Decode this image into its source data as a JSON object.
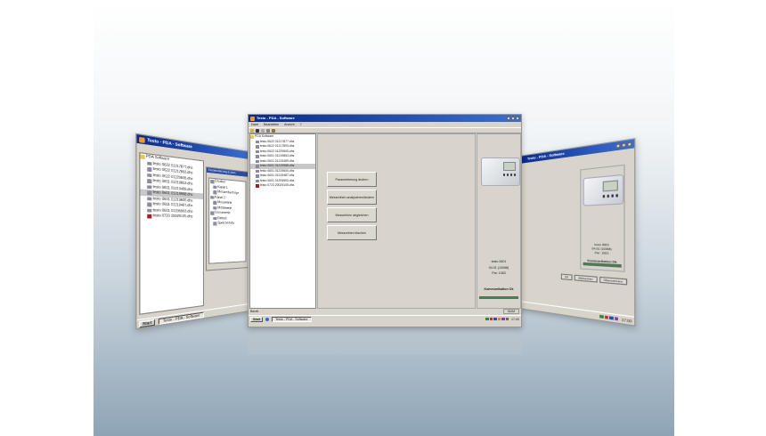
{
  "app": {
    "title": "Testo - PDA - Software",
    "menu": [
      "Datei",
      "Bearbeiten",
      "Ansicht",
      "?"
    ]
  },
  "tree": {
    "root": "PDA Software",
    "items": [
      "testo 0622 01217877.dhs",
      "testo 0622 01217893.dhs",
      "testo 0622 01229505.dhs",
      "testo 0601 01219853.dhs",
      "testo 0601 01219489.dhs",
      "testo 0601 01219988.dhs",
      "testo 0601 01219600.dhs",
      "testo 0601 01219487.dhs",
      "testo 0601 01205993.dhs",
      "testo 0723 20029105.dhs"
    ],
    "selected_index": 5
  },
  "actions": [
    "Parametrierung ändern",
    "Messreihen analysieren/ändern",
    "Messreihen abgleichen",
    "Messreihen löschen"
  ],
  "device": {
    "model": "testo 0601",
    "firmware": "04.01 (10068)",
    "param": "Par: 1063",
    "status": "Kommunikation Ok"
  },
  "statusbar": {
    "left": "Bereit",
    "right": "NUM"
  },
  "taskbar": {
    "start": "Start",
    "item": "Testo - PDA - Software",
    "clock": "17:00"
  },
  "left_window": {
    "panel_title": "Parametrierung ändern",
    "items": [
      "Drucker",
      "Kanal 1",
      "Messreihenfolge",
      "Kanal 2",
      "Messwerte",
      "Mittelwerte",
      "Grenzwerte",
      "Einheit",
      "Speicherinfo"
    ]
  },
  "right_window": {
    "buttons": [
      "OK",
      "Abbrechen",
      "Übernehmen"
    ]
  },
  "colors": {
    "titlebar": "#0a2a8a",
    "window": "#d8d4cc",
    "progress": "#1f9a3e",
    "background_bottom": "#8ea4b6"
  }
}
